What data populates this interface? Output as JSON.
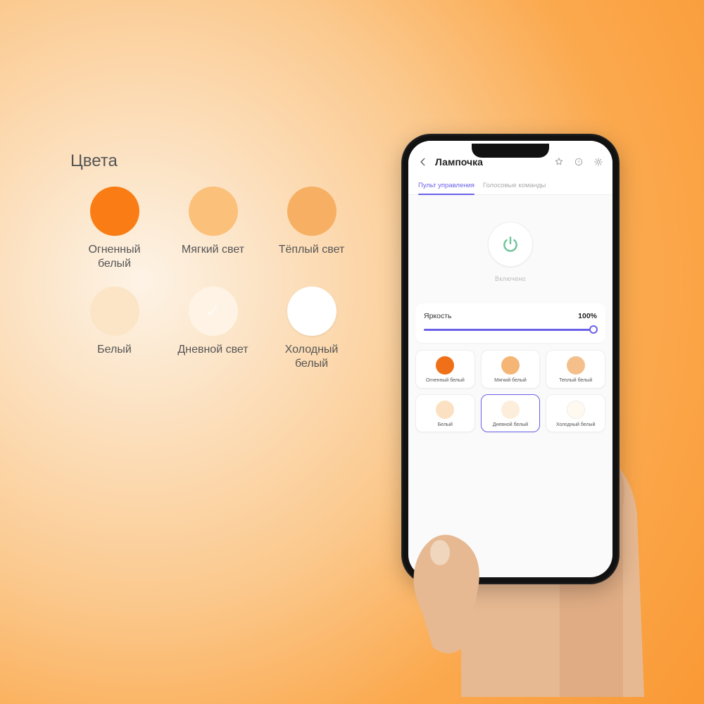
{
  "palette": {
    "title": "Цвета",
    "items": [
      {
        "label": "Огненный\nбелый",
        "color": "#f97d14"
      },
      {
        "label": "Мягкий свет",
        "color": "#fbc07a"
      },
      {
        "label": "Тёплый свет",
        "color": "#f7b063"
      },
      {
        "label": "Белый",
        "color": "#fce5c6"
      },
      {
        "label": "Дневной свет",
        "color": "#fef3e4",
        "checked": true
      },
      {
        "label": "Холодный\nбелый",
        "color": "#ffffff"
      }
    ]
  },
  "app": {
    "header": {
      "title": "Лампочка"
    },
    "tabs": [
      {
        "label": "Пульт управления",
        "active": true
      },
      {
        "label": "Голосовые команды",
        "active": false
      }
    ],
    "power": {
      "state_label": "Включено",
      "accent": "#6cc39a"
    },
    "brightness": {
      "label": "Яркость",
      "value_text": "100%",
      "value": 100
    },
    "colors": [
      {
        "label": "Огненный белый",
        "color": "#ef7018"
      },
      {
        "label": "Мягкий белый",
        "color": "#f5b574"
      },
      {
        "label": "Теплый белый",
        "color": "#f4bf8a"
      },
      {
        "label": "Белый",
        "color": "#fbe1c2"
      },
      {
        "label": "Дневной белый",
        "color": "#fdeedb",
        "selected": true
      },
      {
        "label": "Холодный белый",
        "color": "#fff9f0"
      }
    ]
  }
}
